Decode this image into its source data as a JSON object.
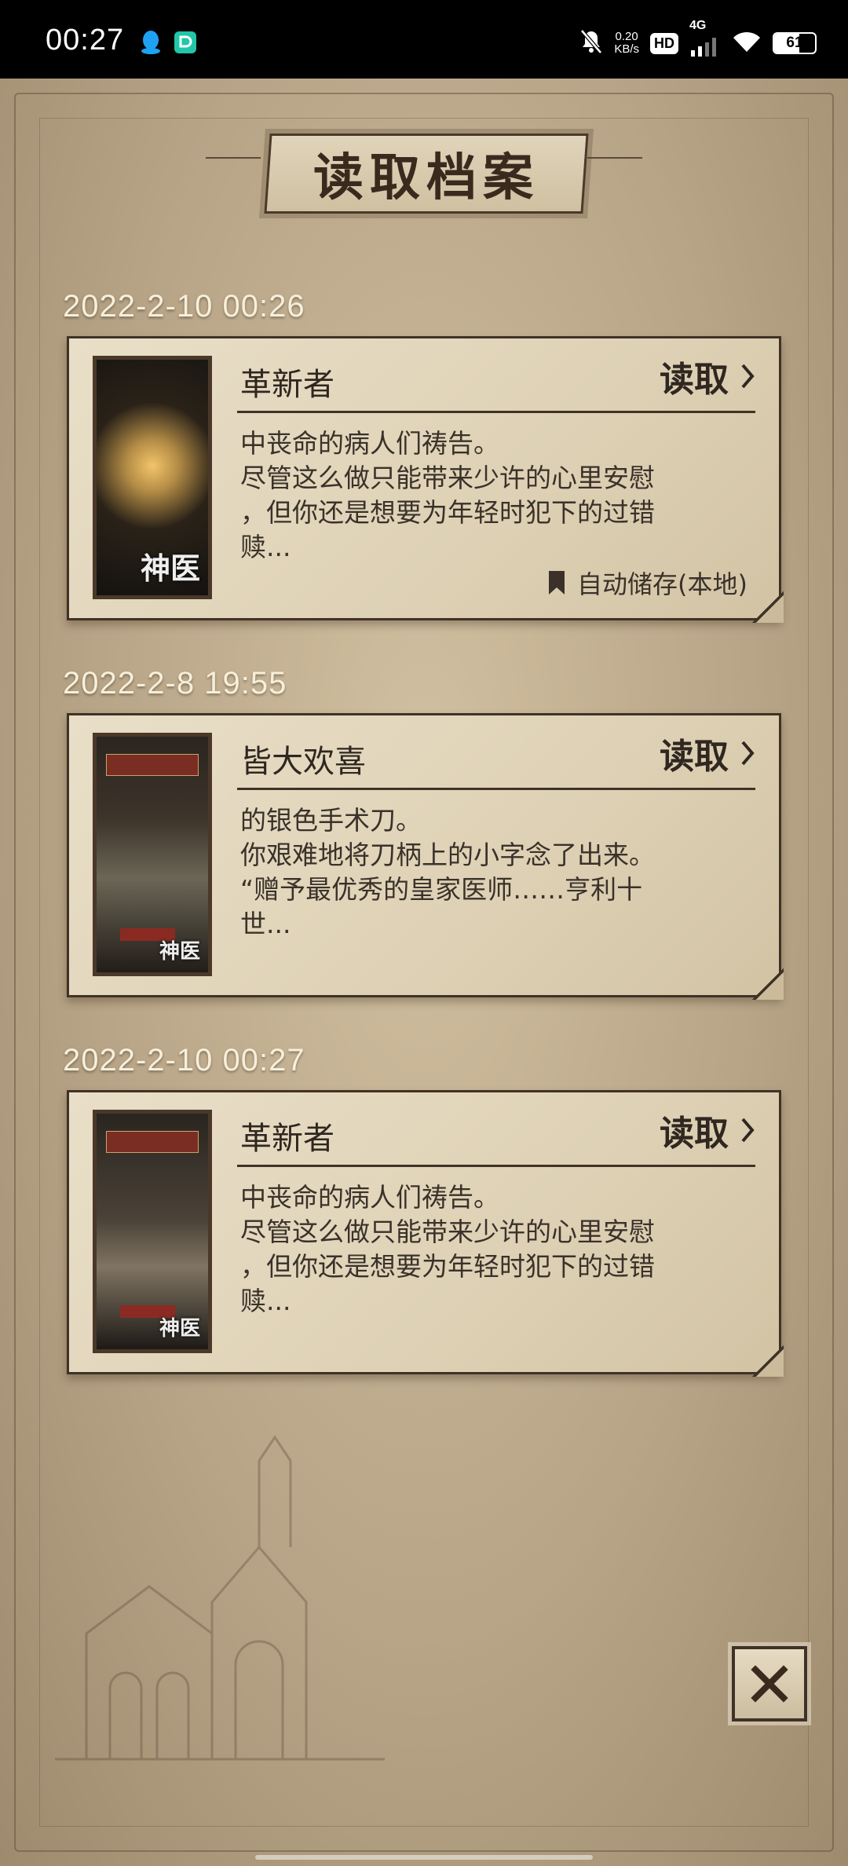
{
  "status_bar": {
    "time": "00:27",
    "net_speed_value": "0.20",
    "net_speed_unit": "KB/s",
    "hd_label": "HD",
    "signal_label": "4G",
    "battery_level": "61",
    "battery_fraction": 0.61
  },
  "page": {
    "title": "读取档案"
  },
  "saves": [
    {
      "date": "2022-2-10  00:26",
      "chapter": "革新者",
      "load_label": "读取",
      "desc_lines": [
        "中丧命的病人们祷告。",
        "尽管这么做只能带来少许的心里安慰",
        "，但你还是想要为年轻时犯下的过错",
        "赎..."
      ],
      "autosave_label": "自动储存(本地)",
      "thumb_logo": "神医"
    },
    {
      "date": "2022-2-8  19:55",
      "chapter": "皆大欢喜",
      "load_label": "读取",
      "desc_lines": [
        "的银色手术刀。",
        "你艰难地将刀柄上的小字念了出来。",
        "“赠予最优秀的皇家医师……亨利十",
        "世..."
      ],
      "thumb_logo": "神医"
    },
    {
      "date": "2022-2-10  00:27",
      "chapter": "革新者",
      "load_label": "读取",
      "desc_lines": [
        "中丧命的病人们祷告。",
        "尽管这么做只能带来少许的心里安慰",
        "，但你还是想要为年轻时犯下的过错",
        "赎..."
      ],
      "thumb_logo": "神医"
    }
  ],
  "icons": {
    "load": "chevron-right-icon",
    "autosave": "bookmark-icon",
    "close": "close-icon"
  },
  "colors": {
    "parchment": "#e9dfc8",
    "ink": "#2f2720",
    "date_text": "#f7efd9"
  }
}
